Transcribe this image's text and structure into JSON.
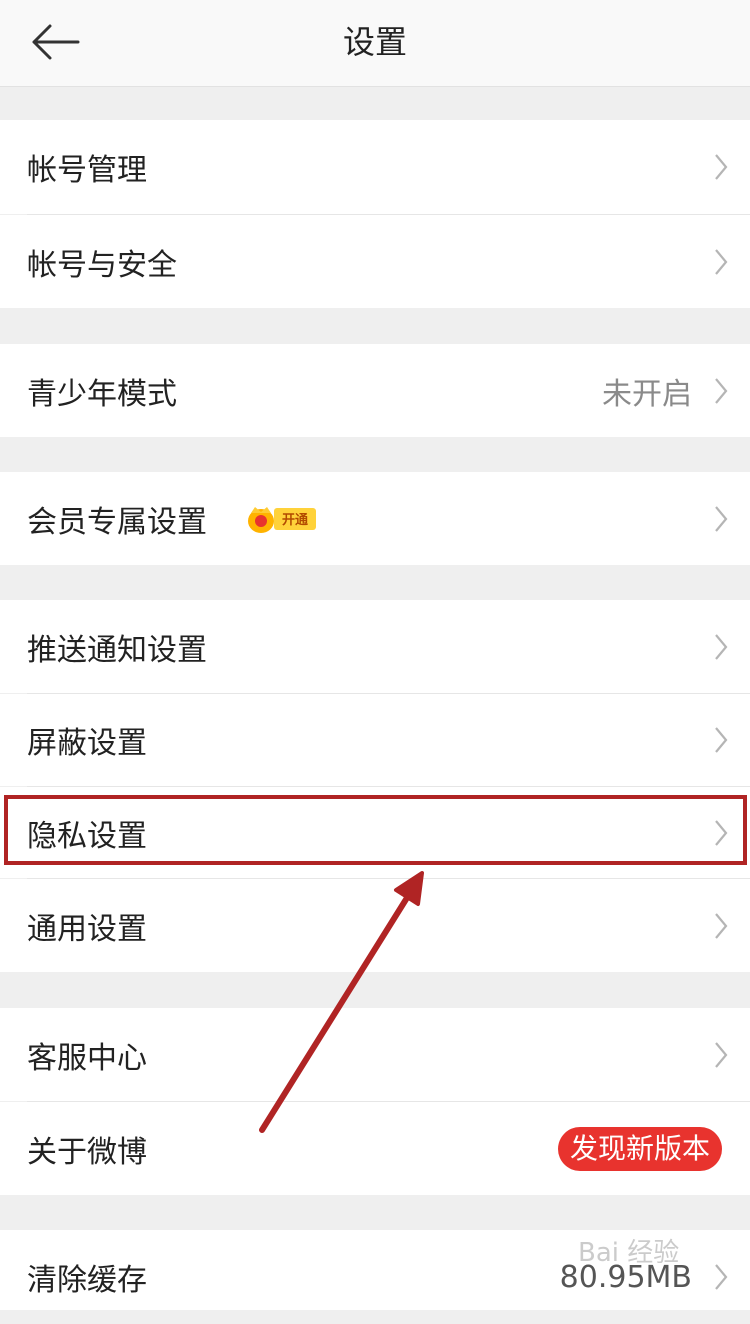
{
  "header": {
    "title": "设置"
  },
  "rows": {
    "account_mgmt": "帐号管理",
    "account_security": "帐号与安全",
    "teen_mode": {
      "label": "青少年模式",
      "value": "未开启"
    },
    "vip_settings": {
      "label": "会员专属设置",
      "badge": "开通"
    },
    "push": "推送通知设置",
    "block": "屏蔽设置",
    "privacy": "隐私设置",
    "general": "通用设置",
    "service": "客服中心",
    "about": {
      "label": "关于微博",
      "badge": "发现新版本"
    },
    "cache": {
      "label": "清除缓存",
      "value": "80.95MB"
    }
  },
  "watermark": "Bai 经验",
  "colors": {
    "highlight": "#b02424",
    "new_badge": "#e8332e",
    "vip": "#ffd23a"
  }
}
